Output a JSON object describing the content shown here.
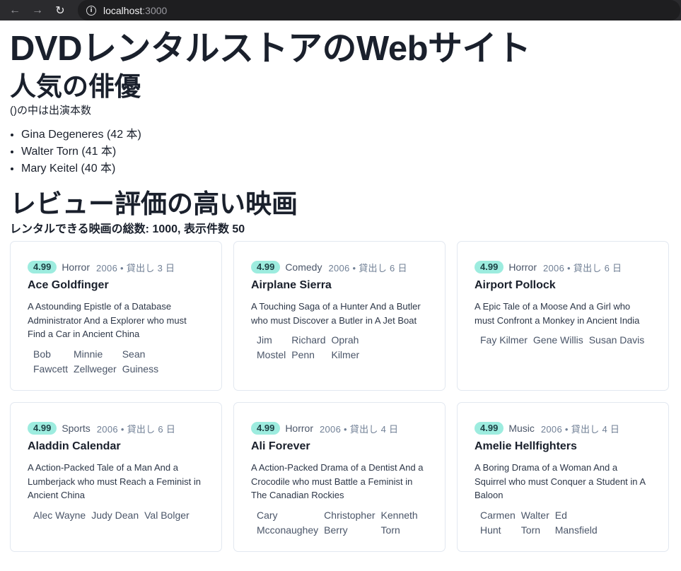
{
  "browser": {
    "host": "localhost",
    "port": ":3000"
  },
  "site_title": "DVDレンタルストアのWebサイト",
  "actors": {
    "heading": "人気の俳優",
    "note": "()の中は出演本数",
    "items": [
      "Gina Degeneres (42 本)",
      "Walter Torn (41 本)",
      "Mary Keitel (40 本)"
    ]
  },
  "films": {
    "heading": "レビュー評価の高い映画",
    "summary": "レンタルできる映画の総数: 1000, 表示件数 50",
    "cards": [
      {
        "rating": "4.99",
        "genre": "Horror",
        "info": "2006 • 貸出し 3 日",
        "title": "Ace Goldfinger",
        "description": "A Astounding Epistle of a Database Administrator And a Explorer who must Find a Car in Ancient China",
        "cast": [
          [
            "Bob",
            "Fawcett"
          ],
          [
            "Minnie",
            "Zellweger"
          ],
          [
            "Sean",
            "Guiness"
          ]
        ]
      },
      {
        "rating": "4.99",
        "genre": "Comedy",
        "info": "2006 • 貸出し 6 日",
        "title": "Airplane Sierra",
        "description": "A Touching Saga of a Hunter And a Butler who must Discover a Butler in A Jet Boat",
        "cast": [
          [
            "Jim",
            "Mostel"
          ],
          [
            "Richard",
            "Penn"
          ],
          [
            "Oprah",
            "Kilmer"
          ]
        ]
      },
      {
        "rating": "4.99",
        "genre": "Horror",
        "info": "2006 • 貸出し 6 日",
        "title": "Airport Pollock",
        "description": "A Epic Tale of a Moose And a Girl who must Confront a Monkey in Ancient India",
        "cast": [
          [
            "Fay Kilmer"
          ],
          [
            "Gene Willis"
          ],
          [
            "Susan Davis"
          ]
        ]
      },
      {
        "rating": "4.99",
        "genre": "Sports",
        "info": "2006 • 貸出し 6 日",
        "title": "Aladdin Calendar",
        "description": "A Action-Packed Tale of a Man And a Lumberjack who must Reach a Feminist in Ancient China",
        "cast": [
          [
            "Alec Wayne"
          ],
          [
            "Judy Dean"
          ],
          [
            "Val Bolger"
          ]
        ]
      },
      {
        "rating": "4.99",
        "genre": "Horror",
        "info": "2006 • 貸出し 4 日",
        "title": "Ali Forever",
        "description": "A Action-Packed Drama of a Dentist And a Crocodile who must Battle a Feminist in The Canadian Rockies",
        "cast": [
          [
            "Cary",
            "Mcconaughey"
          ],
          [
            "Christopher",
            "Berry"
          ],
          [
            "Kenneth",
            "Torn"
          ]
        ]
      },
      {
        "rating": "4.99",
        "genre": "Music",
        "info": "2006 • 貸出し 4 日",
        "title": "Amelie Hellfighters",
        "description": "A Boring Drama of a Woman And a Squirrel who must Conquer a Student in A Baloon",
        "cast": [
          [
            "Carmen",
            "Hunt"
          ],
          [
            "Walter",
            "Torn"
          ],
          [
            "Ed",
            "Mansfield"
          ]
        ]
      }
    ]
  }
}
